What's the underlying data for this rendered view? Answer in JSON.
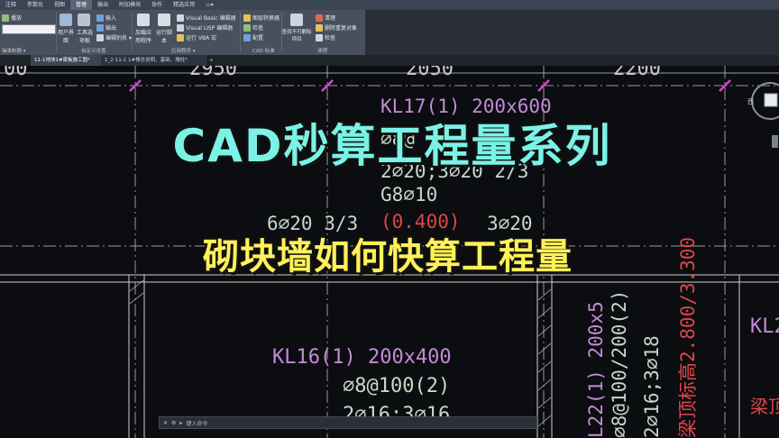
{
  "ribbon": {
    "tabs": [
      "注释",
      "参数化",
      "视图",
      "管理",
      "输出",
      "附加模块",
      "协作",
      "精选应用",
      "▭▾"
    ],
    "active_tab_index": 3,
    "left_items": [
      "播放",
      "输入",
      "输出"
    ],
    "left_group": "操录制器 ▾",
    "custom_group": {
      "items": [
        {
          "label": "用户界面"
        },
        {
          "label": "工具选项板"
        },
        {
          "label": "编辑别名 ▾"
        }
      ],
      "group_label": "自定义设置"
    },
    "app_group": {
      "items": [
        "加载应用程序",
        "运行脚本",
        "Visual Basic 编辑器",
        "Visual LISP 编辑器",
        "运行 VBA 宏"
      ],
      "group_label": "应用程序 ▾"
    },
    "cad_group": {
      "items": [
        "图层转换器",
        "检查",
        "配置"
      ],
      "group_label": "CAD 标准"
    },
    "cleanup_group": {
      "items": [
        "查找不可删除项目",
        "清理",
        "删除重复对象",
        "检查"
      ],
      "group_label": "清理"
    }
  },
  "doc_tabs": [
    "11-1地块1#梁板施工图*",
    "1_2-11-1 1#楼总说明、基础、墙柱*"
  ],
  "drawing": {
    "dims": [
      "2950",
      "2050",
      "2200",
      "00"
    ],
    "beam_texts": [
      {
        "text": "KL17(1) 200x600",
        "color": "#c48ad8"
      },
      {
        "text": "⌀8@",
        "color": "#c8d8c8"
      },
      {
        "text": "2⌀20;3⌀20 2/3",
        "color": "#c8d8c8"
      },
      {
        "text": "G8⌀10",
        "color": "#c8d8c8"
      },
      {
        "text": "(0.400)",
        "color": "#e0464a"
      },
      {
        "text": "6⌀20 3/3",
        "color": "#c8d8c8"
      },
      {
        "text": "3⌀20",
        "color": "#c8d8c8"
      },
      {
        "text": "KL16(1) 200x400",
        "color": "#c48ad8"
      },
      {
        "text": "⌀8@100(2)",
        "color": "#c8d8c8"
      },
      {
        "text": "2⌀16;3⌀16",
        "color": "#c8d8c8"
      }
    ],
    "vertical_texts": [
      {
        "text": "L22(1) 200x5",
        "color": "#c48ad8"
      },
      {
        "text": "⌀8@100/200(2)",
        "color": "#c8d8c8"
      },
      {
        "text": "2⌀16;3⌀18",
        "color": "#c8d8c8"
      },
      {
        "text": "梁顶标高2.800/3.300",
        "color": "#e0464a"
      }
    ],
    "right_texts": [
      "KL2",
      "梁顶"
    ],
    "compass_label": "西"
  },
  "overlay": {
    "title": "CAD秒算工程量系列",
    "subtitle": "砌块墙如何快算工程量"
  },
  "command": {
    "placeholder": "键入命令"
  },
  "colors": {
    "title": "#7af3e6",
    "subtitle": "#fff15a",
    "magenta": "#e040e0",
    "axis": "#c8c8c8"
  }
}
